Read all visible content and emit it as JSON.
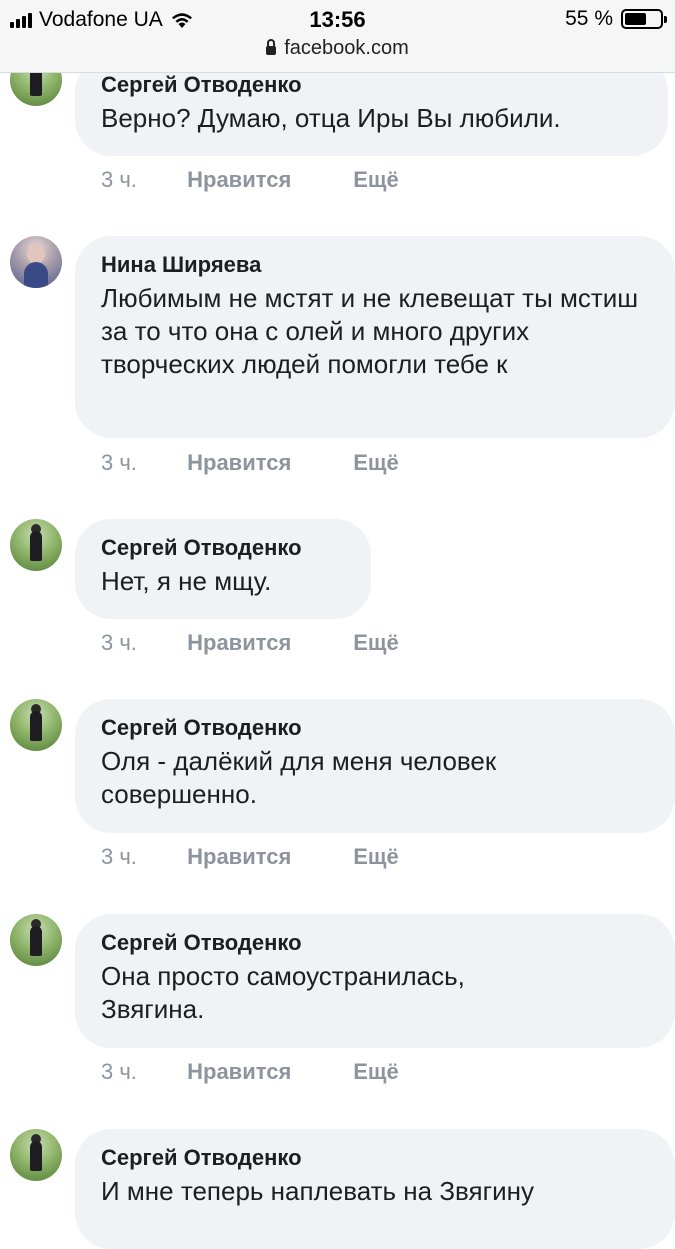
{
  "status_bar": {
    "carrier": "Vodafone UA",
    "time": "13:56",
    "battery": "55 %",
    "battery_level": 0.55,
    "url": "facebook.com"
  },
  "comments": [
    {
      "author": "Сергей Отводенко",
      "text": "Верно? Думаю, отца Иры Вы любили.",
      "time": "3 ч.",
      "like": "Нравится",
      "more": "Ещё"
    },
    {
      "author": "Нина Ширяева",
      "text": "Любимым не мстят и не клевещат ты мстиш за то что она с олей и много других творческих людей помогли тебе к",
      "time": "3 ч.",
      "like": "Нравится",
      "more": "Ещё"
    },
    {
      "author": "Сергей Отводенко",
      "text": "Нет, я не мщу.",
      "time": "3 ч.",
      "like": "Нравится",
      "more": "Ещё"
    },
    {
      "author": "Сергей Отводенко",
      "text": "Оля - далёкий для меня человек совершенно.",
      "time": "3 ч.",
      "like": "Нравится",
      "more": "Ещё"
    },
    {
      "author": "Сергей Отводенко",
      "text": "Она просто самоустранилась, Звягина.",
      "time": "3 ч.",
      "like": "Нравится",
      "more": "Ещё"
    },
    {
      "author": "Сергей Отводенко",
      "text": "И мне теперь наплевать на Звягину",
      "time": "",
      "like": "",
      "more": ""
    }
  ],
  "icons": [
    "signal-icon",
    "wifi-icon",
    "battery-icon",
    "lock-icon",
    "avatar"
  ]
}
